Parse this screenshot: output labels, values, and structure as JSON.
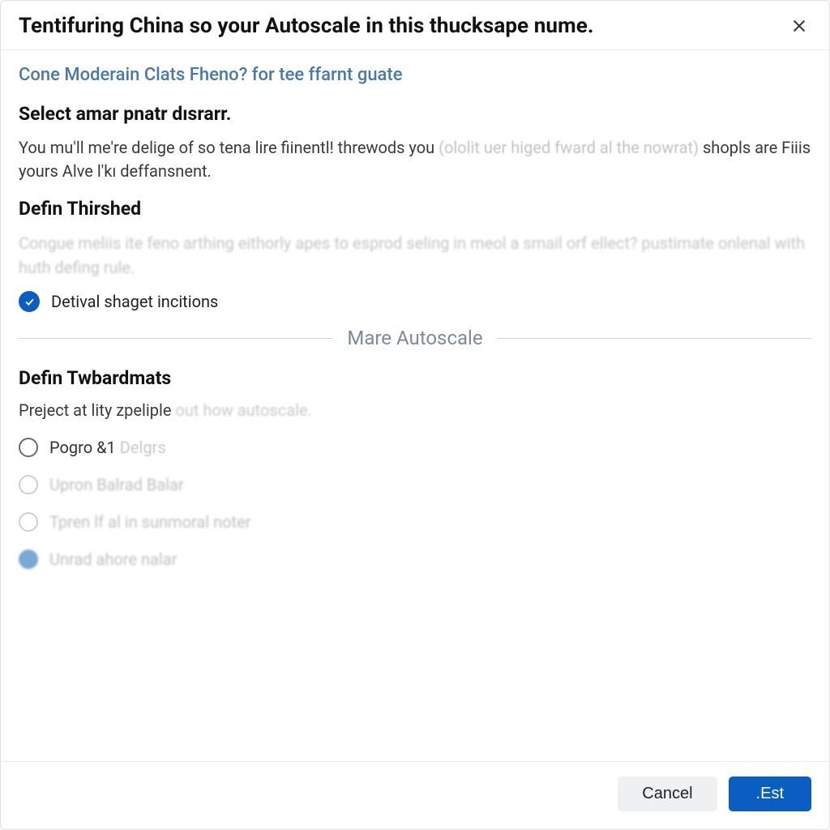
{
  "header": {
    "title": "Tentifuring China so your Autoscale in this thucksape nume."
  },
  "link": "Cone Moderain Clats Fheno? for tee ffarnt guate",
  "section1": {
    "title": "Select amar pnatr dısrarr.",
    "para_a": "You mu'll me're delige of so tena lire fiinentl! threwods you ",
    "para_faded": "(ololit uer higed fward al the nowrat)",
    "para_b": " shopls are Fiiis yours Alve l'kı deffansnent."
  },
  "section2": {
    "title": "Defin Thirshed",
    "blur_text": "Congue meliis ite feno arthing eithorly apes to esprod seling in meol a smail orf ellect? pustimate onlenal with huth defing rule.",
    "checkbox_label": "Detival shaget incitions"
  },
  "divider": "Mare Autoscale",
  "section3": {
    "title": "Defin Twbardmats",
    "sub_a": "Preject at lity zpeliple ",
    "sub_faded": "out how autoscale."
  },
  "radios": [
    {
      "main": "Pogro &1 ",
      "tail": "Delgrs",
      "style": "partfade",
      "ring": "dark",
      "filled": false
    },
    {
      "main": "Upron Balrad Balar",
      "tail": "",
      "style": "fullfade",
      "ring": "light",
      "filled": false
    },
    {
      "main": "Tpren lf al in sunmoral noter",
      "tail": "",
      "style": "fullfade",
      "ring": "light",
      "filled": false
    },
    {
      "main": "Unrad ahore nalar",
      "tail": "",
      "style": "fullfade",
      "ring": "filled",
      "filled": true
    }
  ],
  "footer": {
    "cancel": "Cancel",
    "confirm": ".Est"
  }
}
